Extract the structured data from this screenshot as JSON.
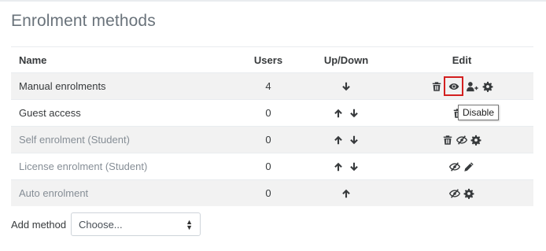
{
  "page": {
    "title": "Enrolment methods"
  },
  "table": {
    "headers": {
      "name": "Name",
      "users": "Users",
      "updown": "Up/Down",
      "edit": "Edit"
    },
    "rows": [
      {
        "name": "Manual enrolments",
        "users": "4",
        "disabled": false,
        "updown": [
          "down"
        ],
        "edit": [
          "delete-icon",
          "eye-icon",
          "enrol-users-icon",
          "gear-icon"
        ]
      },
      {
        "name": "Guest access",
        "users": "0",
        "disabled": false,
        "updown": [
          "up",
          "down"
        ],
        "edit": [
          "delete-icon"
        ]
      },
      {
        "name": "Self enrolment (Student)",
        "users": "0",
        "disabled": true,
        "updown": [
          "up",
          "down"
        ],
        "edit": [
          "delete-icon",
          "eye-slash-icon",
          "gear-icon"
        ]
      },
      {
        "name": "License enrolment (Student)",
        "users": "0",
        "disabled": true,
        "updown": [
          "up",
          "down"
        ],
        "edit": [
          "eye-slash-icon",
          "pencil-icon"
        ]
      },
      {
        "name": "Auto enrolment",
        "users": "0",
        "disabled": true,
        "updown": [
          "up"
        ],
        "edit": [
          "eye-slash-icon",
          "gear-icon"
        ]
      }
    ]
  },
  "tooltip": {
    "text": "Disable"
  },
  "add_method": {
    "label": "Add method",
    "select_value": "Choose..."
  },
  "colors": {
    "icon": "#373a3c",
    "highlight": "#d32020",
    "stripe": "#f2f2f2"
  }
}
